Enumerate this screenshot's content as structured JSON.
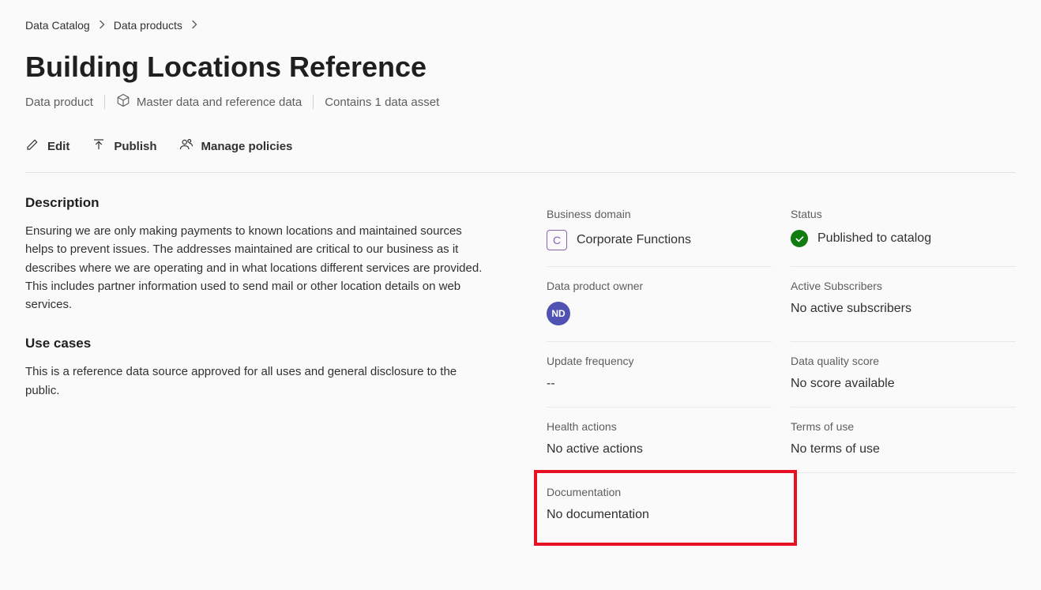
{
  "breadcrumb": {
    "items": [
      "Data Catalog",
      "Data products"
    ]
  },
  "page": {
    "title": "Building Locations Reference",
    "type_label": "Data product",
    "category_label": "Master data and reference data",
    "asset_count_label": "Contains 1 data asset"
  },
  "actions": {
    "edit": "Edit",
    "publish": "Publish",
    "manage_policies": "Manage policies"
  },
  "left": {
    "description_heading": "Description",
    "description_body": "Ensuring we are only making payments to known locations and maintained sources helps to prevent issues.  The addresses maintained are critical to our business as it describes where we are operating and in what locations different services are provided.  This includes partner information used to send mail or other location details on web services.",
    "usecases_heading": "Use cases",
    "usecases_body": "This is a reference data source approved for all uses and general disclosure to the public."
  },
  "props": {
    "business_domain": {
      "label": "Business domain",
      "badge": "C",
      "value": "Corporate Functions"
    },
    "status": {
      "label": "Status",
      "value": "Published to catalog"
    },
    "owner": {
      "label": "Data product owner",
      "initials": "ND"
    },
    "subscribers": {
      "label": "Active Subscribers",
      "value": "No active subscribers"
    },
    "update_freq": {
      "label": "Update frequency",
      "value": "--"
    },
    "quality": {
      "label": "Data quality score",
      "value": "No score available"
    },
    "health": {
      "label": "Health actions",
      "value": "No active actions"
    },
    "terms": {
      "label": "Terms of use",
      "value": "No terms of use"
    },
    "documentation": {
      "label": "Documentation",
      "value": "No documentation"
    }
  }
}
